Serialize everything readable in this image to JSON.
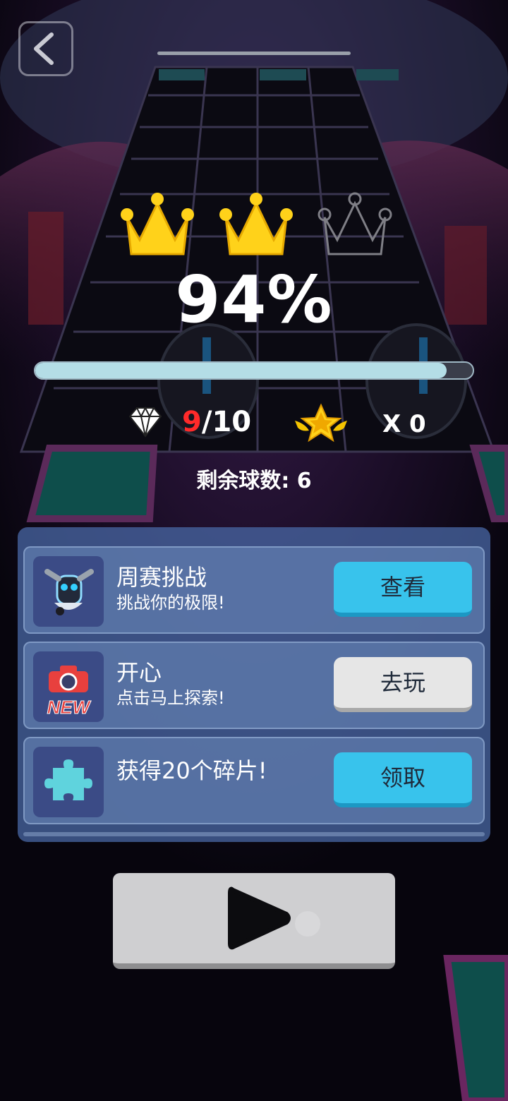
{
  "result": {
    "crowns_earned": 2,
    "crowns_total": 3,
    "percent_text": "94%",
    "progress": 0.94
  },
  "stats": {
    "gems_collected": "9",
    "gems_total": "/10",
    "stars_text": "X 0"
  },
  "balls_left_text": "剩余球数: 6",
  "tasks": [
    {
      "title": "周赛挑战",
      "subtitle": "挑战你的极限!",
      "button": "查看",
      "icon": "robot-icon"
    },
    {
      "title": "开心",
      "subtitle": "点击马上探索!",
      "button": "去玩",
      "icon": "new-camera-icon",
      "badge": "NEW"
    },
    {
      "title": "获得20个碎片!",
      "subtitle": "",
      "button": "领取",
      "icon": "puzzle-piece-icon"
    }
  ],
  "colors": {
    "accent_blue": "#38c3ec",
    "crown_gold": "#ffd21a",
    "gem_red": "#ff2a2a",
    "progress_fill": "#b4dde6"
  }
}
